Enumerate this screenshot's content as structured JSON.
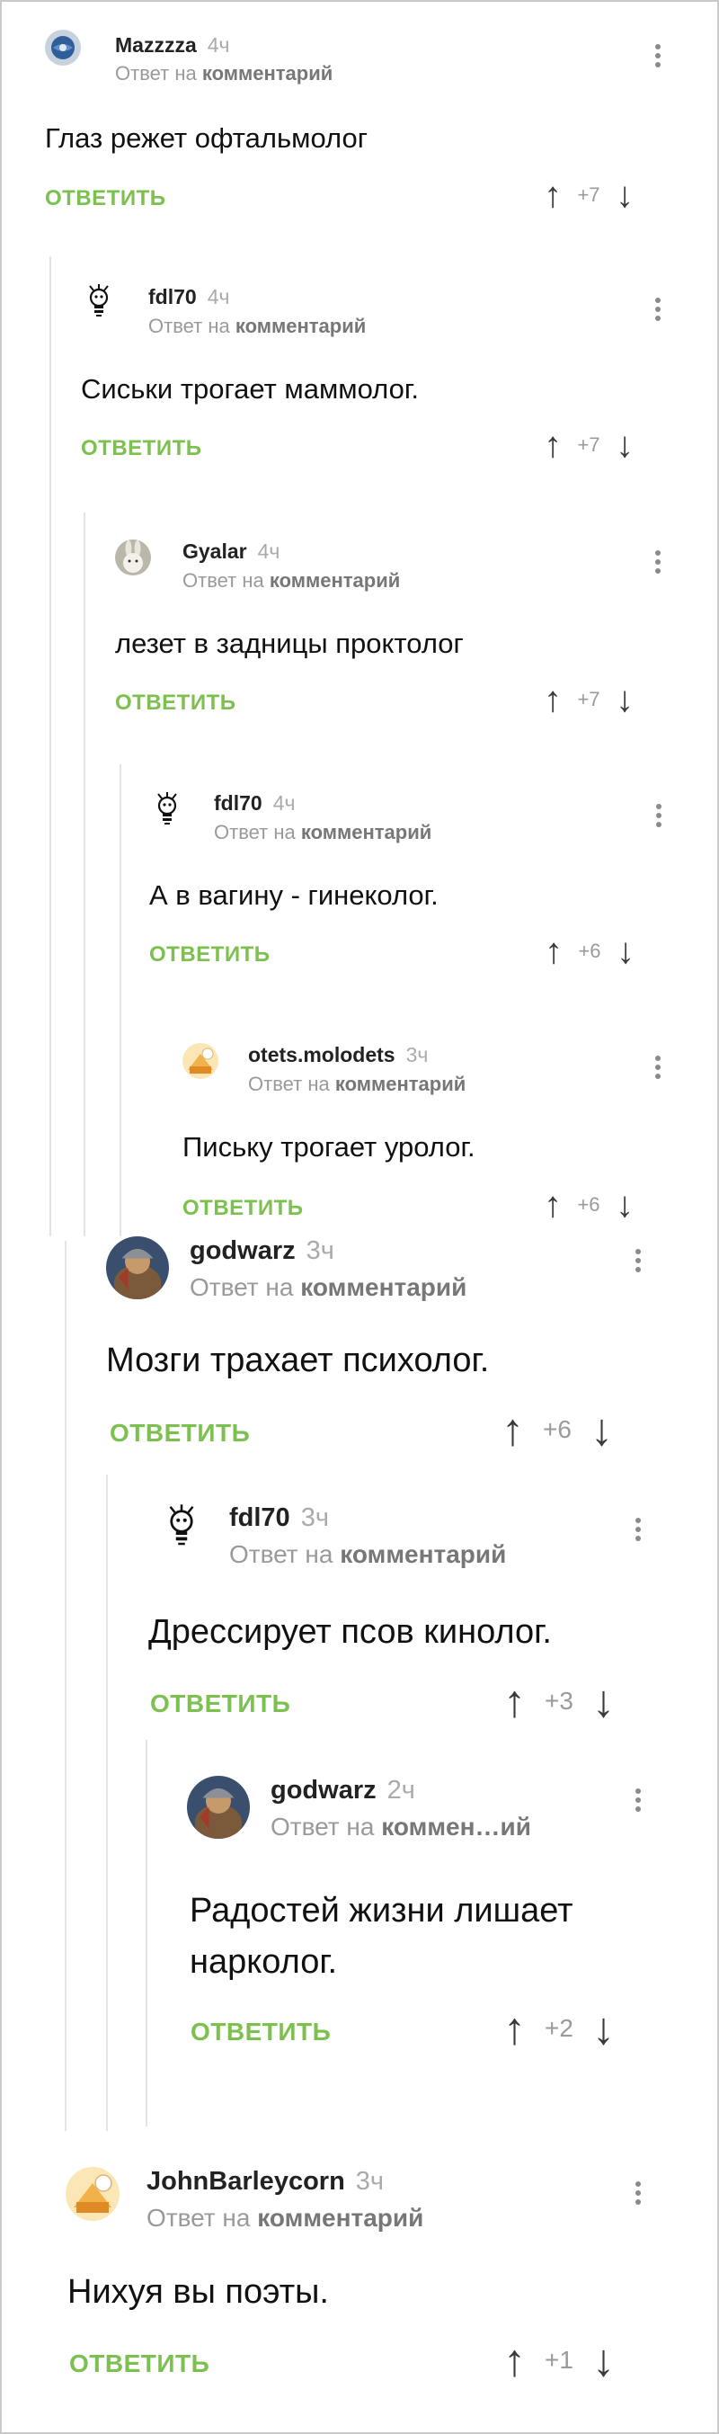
{
  "labels": {
    "reply_prefix": "Ответ на",
    "reply_target": "комментарий",
    "reply_target_short": "коммен…ий",
    "answer": "ОТВЕТИТЬ",
    "up_arrow": "↑",
    "down_arrow": "↓"
  },
  "comments": [
    {
      "author": "Mazzzza",
      "time": "4ч",
      "text": "Глаз режет офтальмолог",
      "rating": "+7",
      "avatar": "globe-avatar"
    },
    {
      "author": "fdl70",
      "time": "4ч",
      "text": "Сиськи трогает маммолог.",
      "rating": "+7",
      "avatar": "bulb-avatar"
    },
    {
      "author": "Gyalar",
      "time": "4ч",
      "text": "лезет в задницы проктолог",
      "rating": "+7",
      "avatar": "rabbit-avatar"
    },
    {
      "author": "fdl70",
      "time": "4ч",
      "text": "А в вагину - гинеколог.",
      "rating": "+6",
      "avatar": "bulb-avatar"
    },
    {
      "author": "otets.molodets",
      "time": "3ч",
      "text": "Письку трогает уролог.",
      "rating": "+6",
      "avatar": "cake-avatar"
    },
    {
      "author": "godwarz",
      "time": "3ч",
      "text": "Мозги трахает психолог.",
      "rating": "+6",
      "avatar": "warrior-avatar"
    },
    {
      "author": "fdl70",
      "time": "3ч",
      "text": "Дрессирует псов кинолог.",
      "rating": "+3",
      "avatar": "bulb-avatar"
    },
    {
      "author": "godwarz",
      "time": "2ч",
      "text_line1": "Радостей жизни лишает",
      "text_line2": "нарколог.",
      "rating": "+2",
      "avatar": "warrior-avatar"
    },
    {
      "author": "JohnBarleycorn",
      "time": "3ч",
      "text": "Нихуя вы поэты.",
      "rating": "+1",
      "avatar": "cake-avatar"
    }
  ],
  "colors": {
    "answer_green": "#7cc04f",
    "muted": "#9a9a9a",
    "thread_line": "#e3e3e3"
  }
}
